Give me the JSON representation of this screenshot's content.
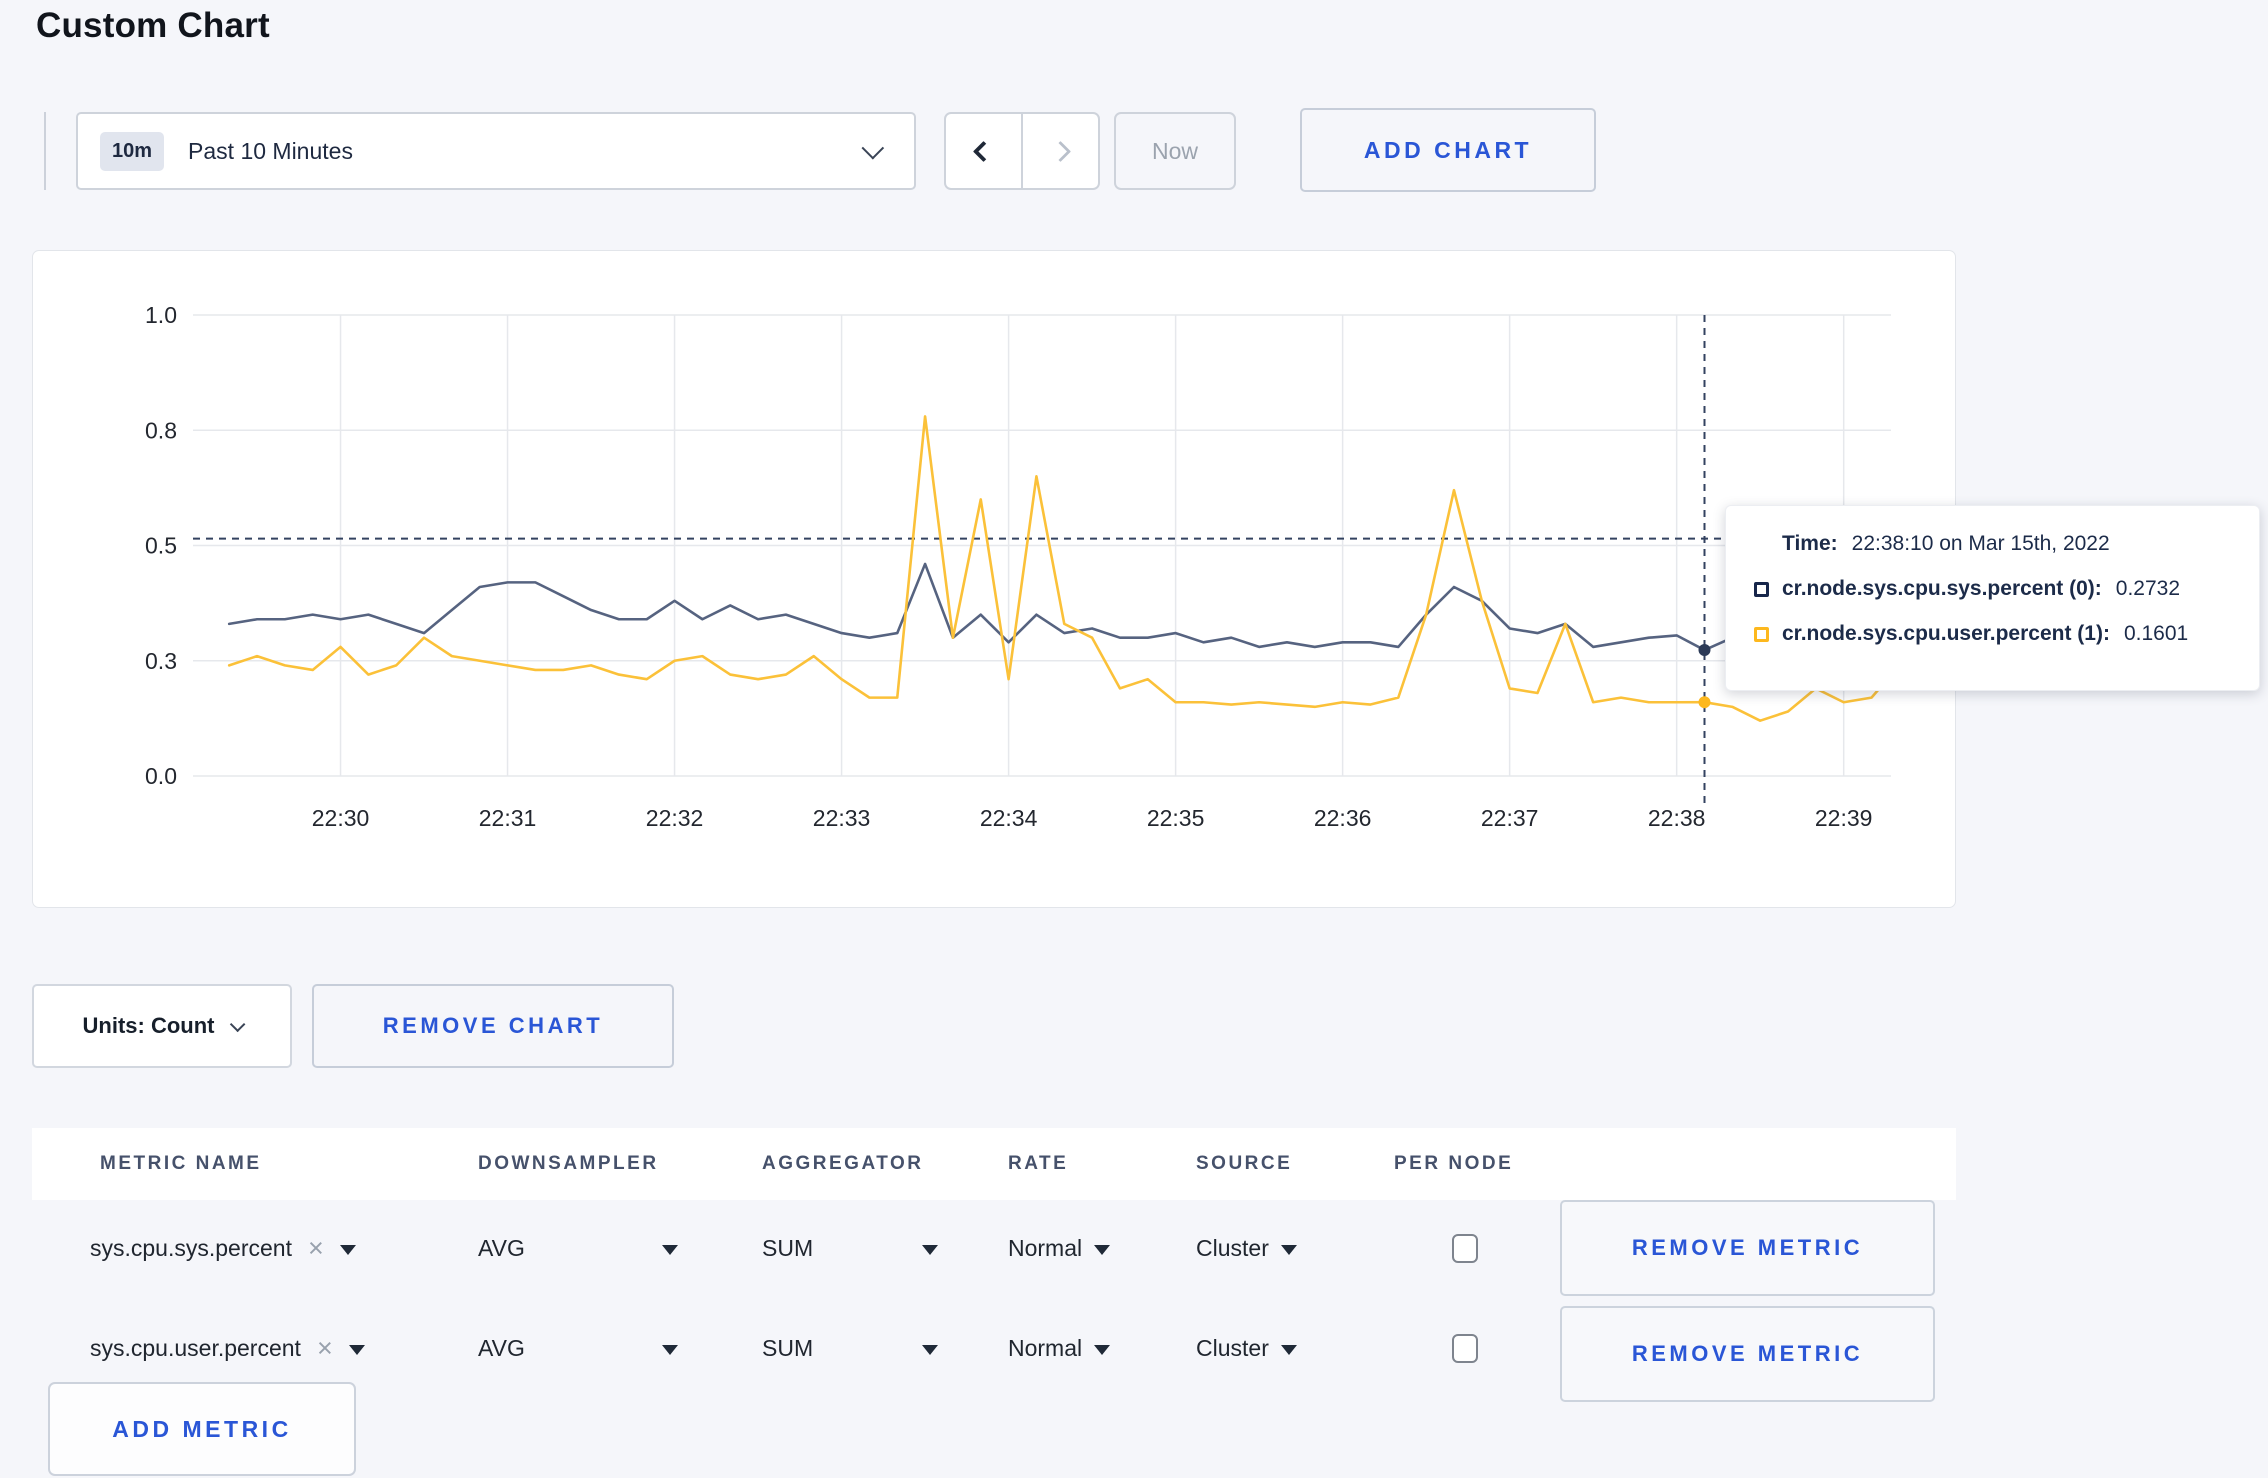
{
  "page": {
    "title": "Custom Chart"
  },
  "colors": {
    "accent_blue": "#2a56d6",
    "page_bg": "#f5f6fa",
    "card_bg": "#ffffff",
    "crosshair": "#334260",
    "grid": "#e6e8ec"
  },
  "icons": {
    "time_range_chevron": "chevron-down",
    "pager_prev": "chevron-left",
    "pager_next": "chevron-right",
    "units_chevron": "chevron-down",
    "metric_remove_tag": "x",
    "dropdown_caret": "triangle-down",
    "per_node": "checkbox-unchecked"
  },
  "toolbar": {
    "time_range": {
      "badge": "10m",
      "label": "Past 10 Minutes"
    },
    "now_label": "Now",
    "add_chart_label": "ADD CHART"
  },
  "chart_data": {
    "type": "line",
    "title": "",
    "grid": true,
    "ylim": [
      0,
      1
    ],
    "x_domain": [
      "22:29:07",
      "22:39:17"
    ],
    "data_start": "22:29:20",
    "step_seconds": 10,
    "x_ticks": [
      "22:30",
      "22:31",
      "22:32",
      "22:33",
      "22:34",
      "22:35",
      "22:36",
      "22:37",
      "22:38",
      "22:39"
    ],
    "y_ticks": [
      {
        "value": 0,
        "label": "0.0"
      },
      {
        "value": 0.25,
        "label": "0.3"
      },
      {
        "value": 0.5,
        "label": "0.5"
      },
      {
        "value": 0.75,
        "label": "0.8"
      },
      {
        "value": 1,
        "label": "1.0"
      }
    ],
    "series": [
      {
        "name": "cr.node.sys.cpu.sys.percent (0)",
        "color": "#566380",
        "marker_color": "#2c3a57",
        "values": [
          0.33,
          0.34,
          0.34,
          0.35,
          0.34,
          0.35,
          0.33,
          0.31,
          0.36,
          0.41,
          0.42,
          0.42,
          0.39,
          0.36,
          0.34,
          0.34,
          0.38,
          0.34,
          0.37,
          0.34,
          0.35,
          0.33,
          0.31,
          0.3,
          0.31,
          0.46,
          0.3,
          0.35,
          0.29,
          0.35,
          0.31,
          0.32,
          0.3,
          0.3,
          0.31,
          0.29,
          0.3,
          0.28,
          0.29,
          0.28,
          0.29,
          0.29,
          0.28,
          0.35,
          0.41,
          0.38,
          0.32,
          0.31,
          0.33,
          0.28,
          0.29,
          0.3,
          0.305,
          0.2732,
          0.3,
          0.29,
          0.3,
          0.29,
          0.3,
          0.31,
          0.3
        ]
      },
      {
        "name": "cr.node.sys.cpu.user.percent (1)",
        "color": "#fbc139",
        "marker_color": "#fdb81e",
        "values": [
          0.24,
          0.26,
          0.24,
          0.23,
          0.28,
          0.22,
          0.24,
          0.3,
          0.26,
          0.25,
          0.24,
          0.23,
          0.23,
          0.24,
          0.22,
          0.21,
          0.25,
          0.26,
          0.22,
          0.21,
          0.22,
          0.26,
          0.21,
          0.17,
          0.17,
          0.78,
          0.3,
          0.6,
          0.21,
          0.65,
          0.33,
          0.3,
          0.19,
          0.21,
          0.16,
          0.16,
          0.155,
          0.16,
          0.155,
          0.15,
          0.16,
          0.155,
          0.17,
          0.35,
          0.62,
          0.38,
          0.19,
          0.18,
          0.33,
          0.16,
          0.17,
          0.16,
          0.16,
          0.1601,
          0.15,
          0.12,
          0.14,
          0.19,
          0.16,
          0.17,
          0.24
        ]
      }
    ],
    "crosshair": {
      "time": "22:38:10",
      "h_value": 0.515,
      "points": [
        {
          "series": 0,
          "value": 0.2732
        },
        {
          "series": 1,
          "value": 0.1601
        }
      ]
    },
    "tooltip": {
      "time_label": "Time:",
      "time_value": "22:38:10 on Mar 15th, 2022",
      "rows": [
        {
          "label": "cr.node.sys.cpu.sys.percent (0):",
          "value": "0.2732",
          "color": "#17264a"
        },
        {
          "label": "cr.node.sys.cpu.user.percent (1):",
          "value": "0.1601",
          "color": "#fdb81e"
        }
      ]
    }
  },
  "units_bar": {
    "units_label": "Units: Count",
    "remove_chart_label": "REMOVE CHART"
  },
  "metrics_table": {
    "headers": [
      "METRIC NAME",
      "DOWNSAMPLER",
      "AGGREGATOR",
      "RATE",
      "SOURCE",
      "PER NODE"
    ],
    "rows": [
      {
        "metric": "sys.cpu.sys.percent",
        "downsampler": "AVG",
        "aggregator": "SUM",
        "rate": "Normal",
        "source": "Cluster",
        "per_node_checked": false,
        "remove_label": "REMOVE METRIC"
      },
      {
        "metric": "sys.cpu.user.percent",
        "downsampler": "AVG",
        "aggregator": "SUM",
        "rate": "Normal",
        "source": "Cluster",
        "per_node_checked": false,
        "remove_label": "REMOVE METRIC"
      }
    ],
    "add_metric_label": "ADD METRIC"
  }
}
